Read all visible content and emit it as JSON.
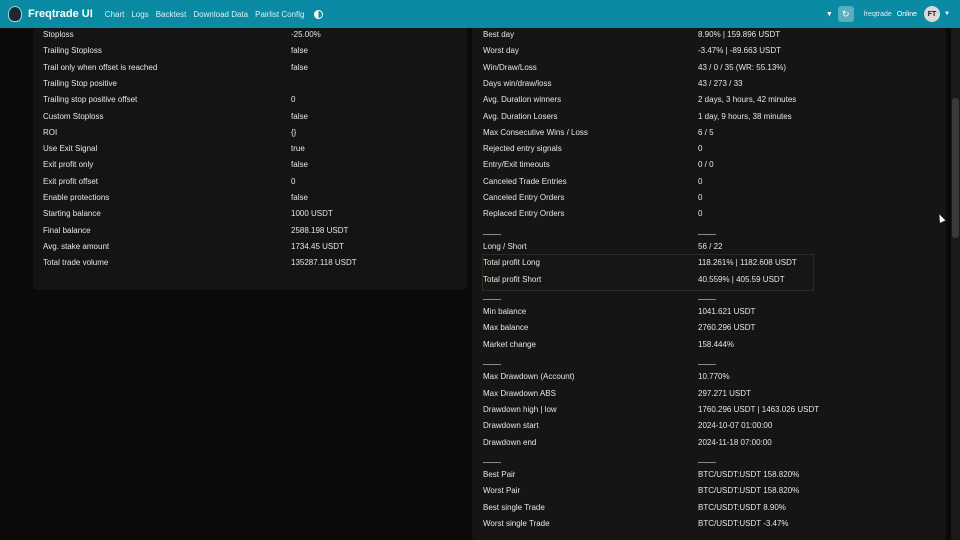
{
  "navbar": {
    "brand": "Freqtrade UI",
    "links": [
      "Chart",
      "Logs",
      "Backtest",
      "Download Data",
      "Pairlist Config"
    ],
    "bot_name": "freqtrade",
    "bot_status": "Online",
    "avatar": "FT",
    "accent_color": "#0b8aa4"
  },
  "left_panel": {
    "rows": [
      {
        "label": "Stoploss",
        "value": "-25.00%"
      },
      {
        "label": "Trailing Stoploss",
        "value": "false"
      },
      {
        "label": "Trail only when offset is reached",
        "value": "false"
      },
      {
        "label": "Trailing Stop positive",
        "value": ""
      },
      {
        "label": "Trailing stop positive offset",
        "value": "0"
      },
      {
        "label": "Custom Stoploss",
        "value": "false"
      },
      {
        "label": "ROI",
        "value": "{}"
      },
      {
        "label": "Use Exit Signal",
        "value": "true"
      },
      {
        "label": "Exit profit only",
        "value": "false"
      },
      {
        "label": "Exit profit offset",
        "value": "0"
      },
      {
        "label": "Enable protections",
        "value": "false"
      },
      {
        "label": "Starting balance",
        "value": "1000 USDT"
      },
      {
        "label": "Final balance",
        "value": "2588.198 USDT"
      },
      {
        "label": "Avg. stake amount",
        "value": "1734.45 USDT"
      },
      {
        "label": "Total trade volume",
        "value": "135287.118 USDT"
      }
    ]
  },
  "right_panel": {
    "rows": [
      {
        "label": "Best day",
        "value": "8.90% | 159.896 USDT"
      },
      {
        "label": "Worst day",
        "value": "-3.47% | -89.663 USDT"
      },
      {
        "label": "Win/Draw/Loss",
        "value": "43 / 0 / 35 (WR: 55.13%)"
      },
      {
        "label": "Days win/draw/loss",
        "value": "43 / 273 / 33"
      },
      {
        "label": "Avg. Duration winners",
        "value": "2 days, 3 hours, 42 minutes"
      },
      {
        "label": "Avg. Duration Losers",
        "value": "1 day, 9 hours, 38 minutes"
      },
      {
        "label": "Max Consecutive Wins / Loss",
        "value": "6 / 5"
      },
      {
        "label": "Rejected entry signals",
        "value": "0"
      },
      {
        "label": "Entry/Exit timeouts",
        "value": "0 / 0"
      },
      {
        "label": "Canceled Trade Entries",
        "value": "0"
      },
      {
        "label": "Canceled Entry Orders",
        "value": "0"
      },
      {
        "label": "Replaced Entry Orders",
        "value": "0"
      },
      {
        "label": "____",
        "value": "____"
      },
      {
        "label": "Long / Short",
        "value": "56 / 22"
      },
      {
        "label": "Total profit Long",
        "value": "118.261% | 1182.608 USDT"
      },
      {
        "label": "Total profit Short",
        "value": "40.559% | 405.59 USDT"
      },
      {
        "label": "____",
        "value": "____"
      },
      {
        "label": "Min balance",
        "value": "1041.621 USDT"
      },
      {
        "label": "Max balance",
        "value": "2760.296 USDT"
      },
      {
        "label": "Market change",
        "value": "158.444%"
      },
      {
        "label": "____",
        "value": "____"
      },
      {
        "label": "Max Drawdown (Account)",
        "value": "10.770%"
      },
      {
        "label": "Max Drawdown ABS",
        "value": "297.271 USDT"
      },
      {
        "label": "Drawdown high | low",
        "value": "1760.296 USDT | 1463.026 USDT"
      },
      {
        "label": "Drawdown start",
        "value": "2024-10-07 01:00:00"
      },
      {
        "label": "Drawdown end",
        "value": "2024-11-18 07:00:00"
      },
      {
        "label": "____",
        "value": "____"
      },
      {
        "label": "Best Pair",
        "value": "BTC/USDT:USDT 158.820%"
      },
      {
        "label": "Worst Pair",
        "value": "BTC/USDT:USDT 158.820%"
      },
      {
        "label": "Best single Trade",
        "value": "BTC/USDT:USDT 8.90%"
      },
      {
        "label": "Worst single Trade",
        "value": "BTC/USDT:USDT -3.47%"
      }
    ]
  }
}
